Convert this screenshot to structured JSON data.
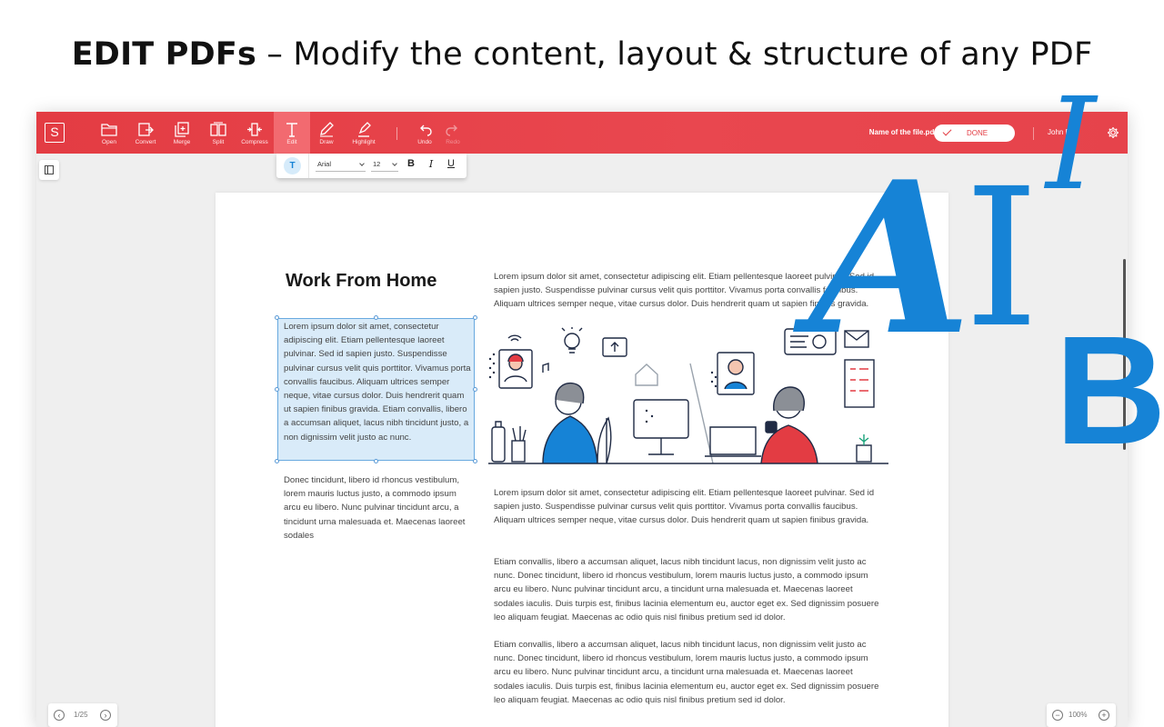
{
  "promo": {
    "headline_bold": "EDIT PDFs",
    "headline_rest": " – Modify the content, layout & structure of any PDF"
  },
  "app": {
    "logo_letter": "S",
    "toolbar": [
      {
        "label": "Open",
        "icon": "folder-icon"
      },
      {
        "label": "Convert",
        "icon": "convert-icon"
      },
      {
        "label": "Merge",
        "icon": "merge-icon"
      },
      {
        "label": "Split",
        "icon": "split-icon"
      },
      {
        "label": "Compress",
        "icon": "compress-icon"
      },
      {
        "label": "Edit",
        "icon": "text-edit-icon",
        "active": true
      },
      {
        "label": "Draw",
        "icon": "pencil-icon"
      },
      {
        "label": "Highlight",
        "icon": "highlighter-icon"
      },
      {
        "label": "Undo",
        "icon": "undo-icon"
      },
      {
        "label": "Redo",
        "icon": "redo-icon",
        "disabled": true
      }
    ],
    "filename": "Name of the file.pdf",
    "done_label": "DONE",
    "user_name": "John Doe",
    "format_bar": {
      "font": "Arial",
      "size": "12",
      "bold": "B",
      "italic": "I",
      "underline": "U"
    },
    "document": {
      "title": "Work From Home",
      "selected_paragraph": "Lorem ipsum dolor sit amet, consectetur adipiscing elit. Etiam pellentesque laoreet pulvinar. Sed id sapien justo. Suspendisse pulvinar cursus velit quis porttitor. Vivamus porta convallis faucibus. Aliquam ultrices semper neque, vitae cursus dolor. Duis hendrerit quam ut sapien finibus gravida. Etiam convallis, libero a accumsan aliquet, lacus nibh tincidunt justo, a non dignissim velit justo ac nunc.",
      "left_paragraph_2": "Donec tincidunt, libero id rhoncus vestibulum, lorem mauris luctus justo, a commodo ipsum arcu eu libero. Nunc pulvinar tincidunt arcu, a tincidunt urna malesuada et. Maecenas laoreet sodales",
      "right_paragraph_1": "Lorem ipsum dolor sit amet, consectetur adipiscing elit. Etiam pellentesque laoreet pulvinar. Sed id sapien justo. Suspendisse pulvinar cursus velit quis porttitor. Vivamus porta convallis faucibus. Aliquam ultrices semper neque, vitae cursus dolor. Duis hendrerit quam ut sapien finibus gravida.",
      "right_paragraph_2": "Lorem ipsum dolor sit amet, consectetur adipiscing elit. Etiam pellentesque laoreet pulvinar. Sed id sapien justo. Suspendisse pulvinar cursus velit quis porttitor. Vivamus porta convallis faucibus. Aliquam ultrices semper neque, vitae cursus dolor. Duis hendrerit quam ut sapien finibus gravida.",
      "right_paragraph_3": "Etiam convallis, libero a accumsan aliquet, lacus nibh tincidunt lacus, non dignissim velit justo ac nunc. Donec tincidunt, libero id rhoncus vestibulum, lorem mauris luctus justo, a commodo ipsum arcu eu libero. Nunc pulvinar tincidunt arcu, a tincidunt urna malesuada et. Maecenas laoreet sodales iaculis. Duis turpis est, finibus lacinia elementum eu, auctor eget ex. Sed dignissim posuere leo aliquam feugiat. Maecenas ac odio quis nisl finibus pretium sed id dolor.",
      "right_paragraph_4": "Etiam convallis, libero a accumsan aliquet, lacus nibh tincidunt lacus, non dignissim velit justo ac nunc. Donec tincidunt, libero id rhoncus vestibulum, lorem mauris luctus justo, a commodo ipsum arcu eu libero. Nunc pulvinar tincidunt arcu, a tincidunt urna malesuada et. Maecenas laoreet sodales iaculis. Duis turpis est, finibus lacinia elementum eu, auctor eget ex. Sed dignissim posuere leo aliquam feugiat. Maecenas ac odio quis nisl finibus pretium sed id dolor."
    },
    "pager": "1/25",
    "zoom": "100%"
  },
  "decoration": {
    "letter_a": "A",
    "letter_i": "I",
    "letter_i_italic": "I",
    "letter_b": "B"
  },
  "colors": {
    "brand_red": "#e33c43",
    "accent_blue": "#1683d6",
    "selection_fill": "#d9ebf9"
  }
}
